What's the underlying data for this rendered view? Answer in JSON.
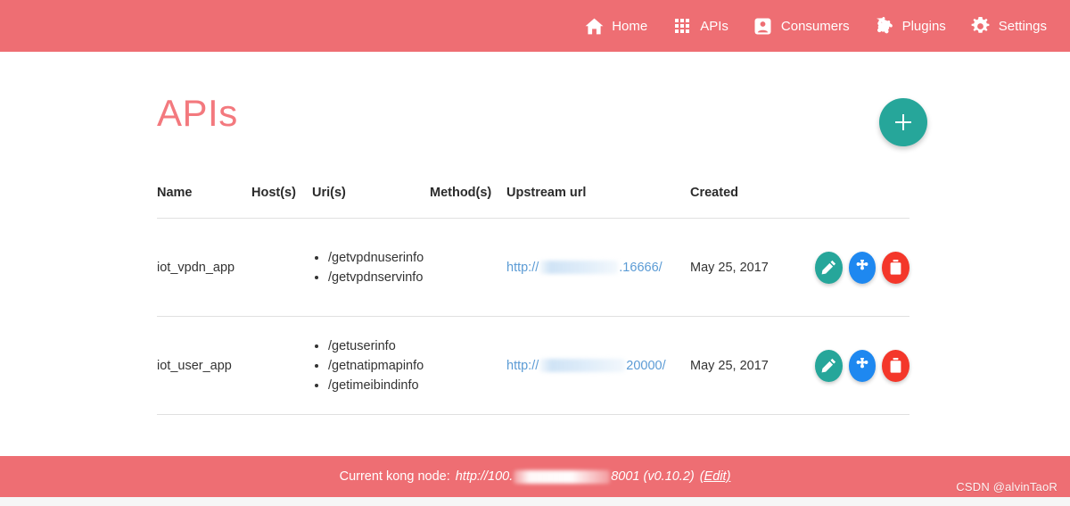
{
  "nav": {
    "items": [
      {
        "label": "Home",
        "icon": "home-icon"
      },
      {
        "label": "APIs",
        "icon": "grid-icon"
      },
      {
        "label": "Consumers",
        "icon": "person-badge-icon"
      },
      {
        "label": "Plugins",
        "icon": "puzzle-piece-icon"
      },
      {
        "label": "Settings",
        "icon": "gear-icon"
      }
    ]
  },
  "page": {
    "title": "APIs",
    "add_button_label": "+"
  },
  "table": {
    "headers": {
      "name": "Name",
      "hosts": "Host(s)",
      "uris": "Uri(s)",
      "methods": "Method(s)",
      "upstream": "Upstream url",
      "created": "Created"
    },
    "rows": [
      {
        "name": "iot_vpdn_app",
        "hosts": "",
        "uris": [
          "/getvpdnuserinfo",
          "/getvpdnservinfo"
        ],
        "methods": "",
        "upstream_prefix": "http://",
        "upstream_suffix": ".16666/",
        "created": "May 25, 2017",
        "actions": {
          "edit": "edit-icon",
          "plugin": "puzzle-piece-icon",
          "delete": "trash-icon"
        }
      },
      {
        "name": "iot_user_app",
        "hosts": "",
        "uris": [
          "/getuserinfo",
          "/getnatipmapinfo",
          "/getimeibindinfo"
        ],
        "methods": "",
        "upstream_prefix": "http://",
        "upstream_suffix": "20000/",
        "created": "May 25, 2017",
        "actions": {
          "edit": "edit-icon",
          "plugin": "puzzle-piece-icon",
          "delete": "trash-icon"
        }
      }
    ]
  },
  "footer": {
    "label": "Current kong node:",
    "node_prefix": "http://100.",
    "node_suffix": "8001 (v0.10.2)",
    "edit_link": "(Edit)"
  },
  "watermark": "CSDN @alvinTaoR",
  "colors": {
    "brand": "#ee6e73",
    "title": "#f3797e",
    "accent_teal": "#26a69a",
    "accent_blue": "#1e88f0",
    "accent_red": "#f4372a",
    "link": "#5b9bd5"
  }
}
